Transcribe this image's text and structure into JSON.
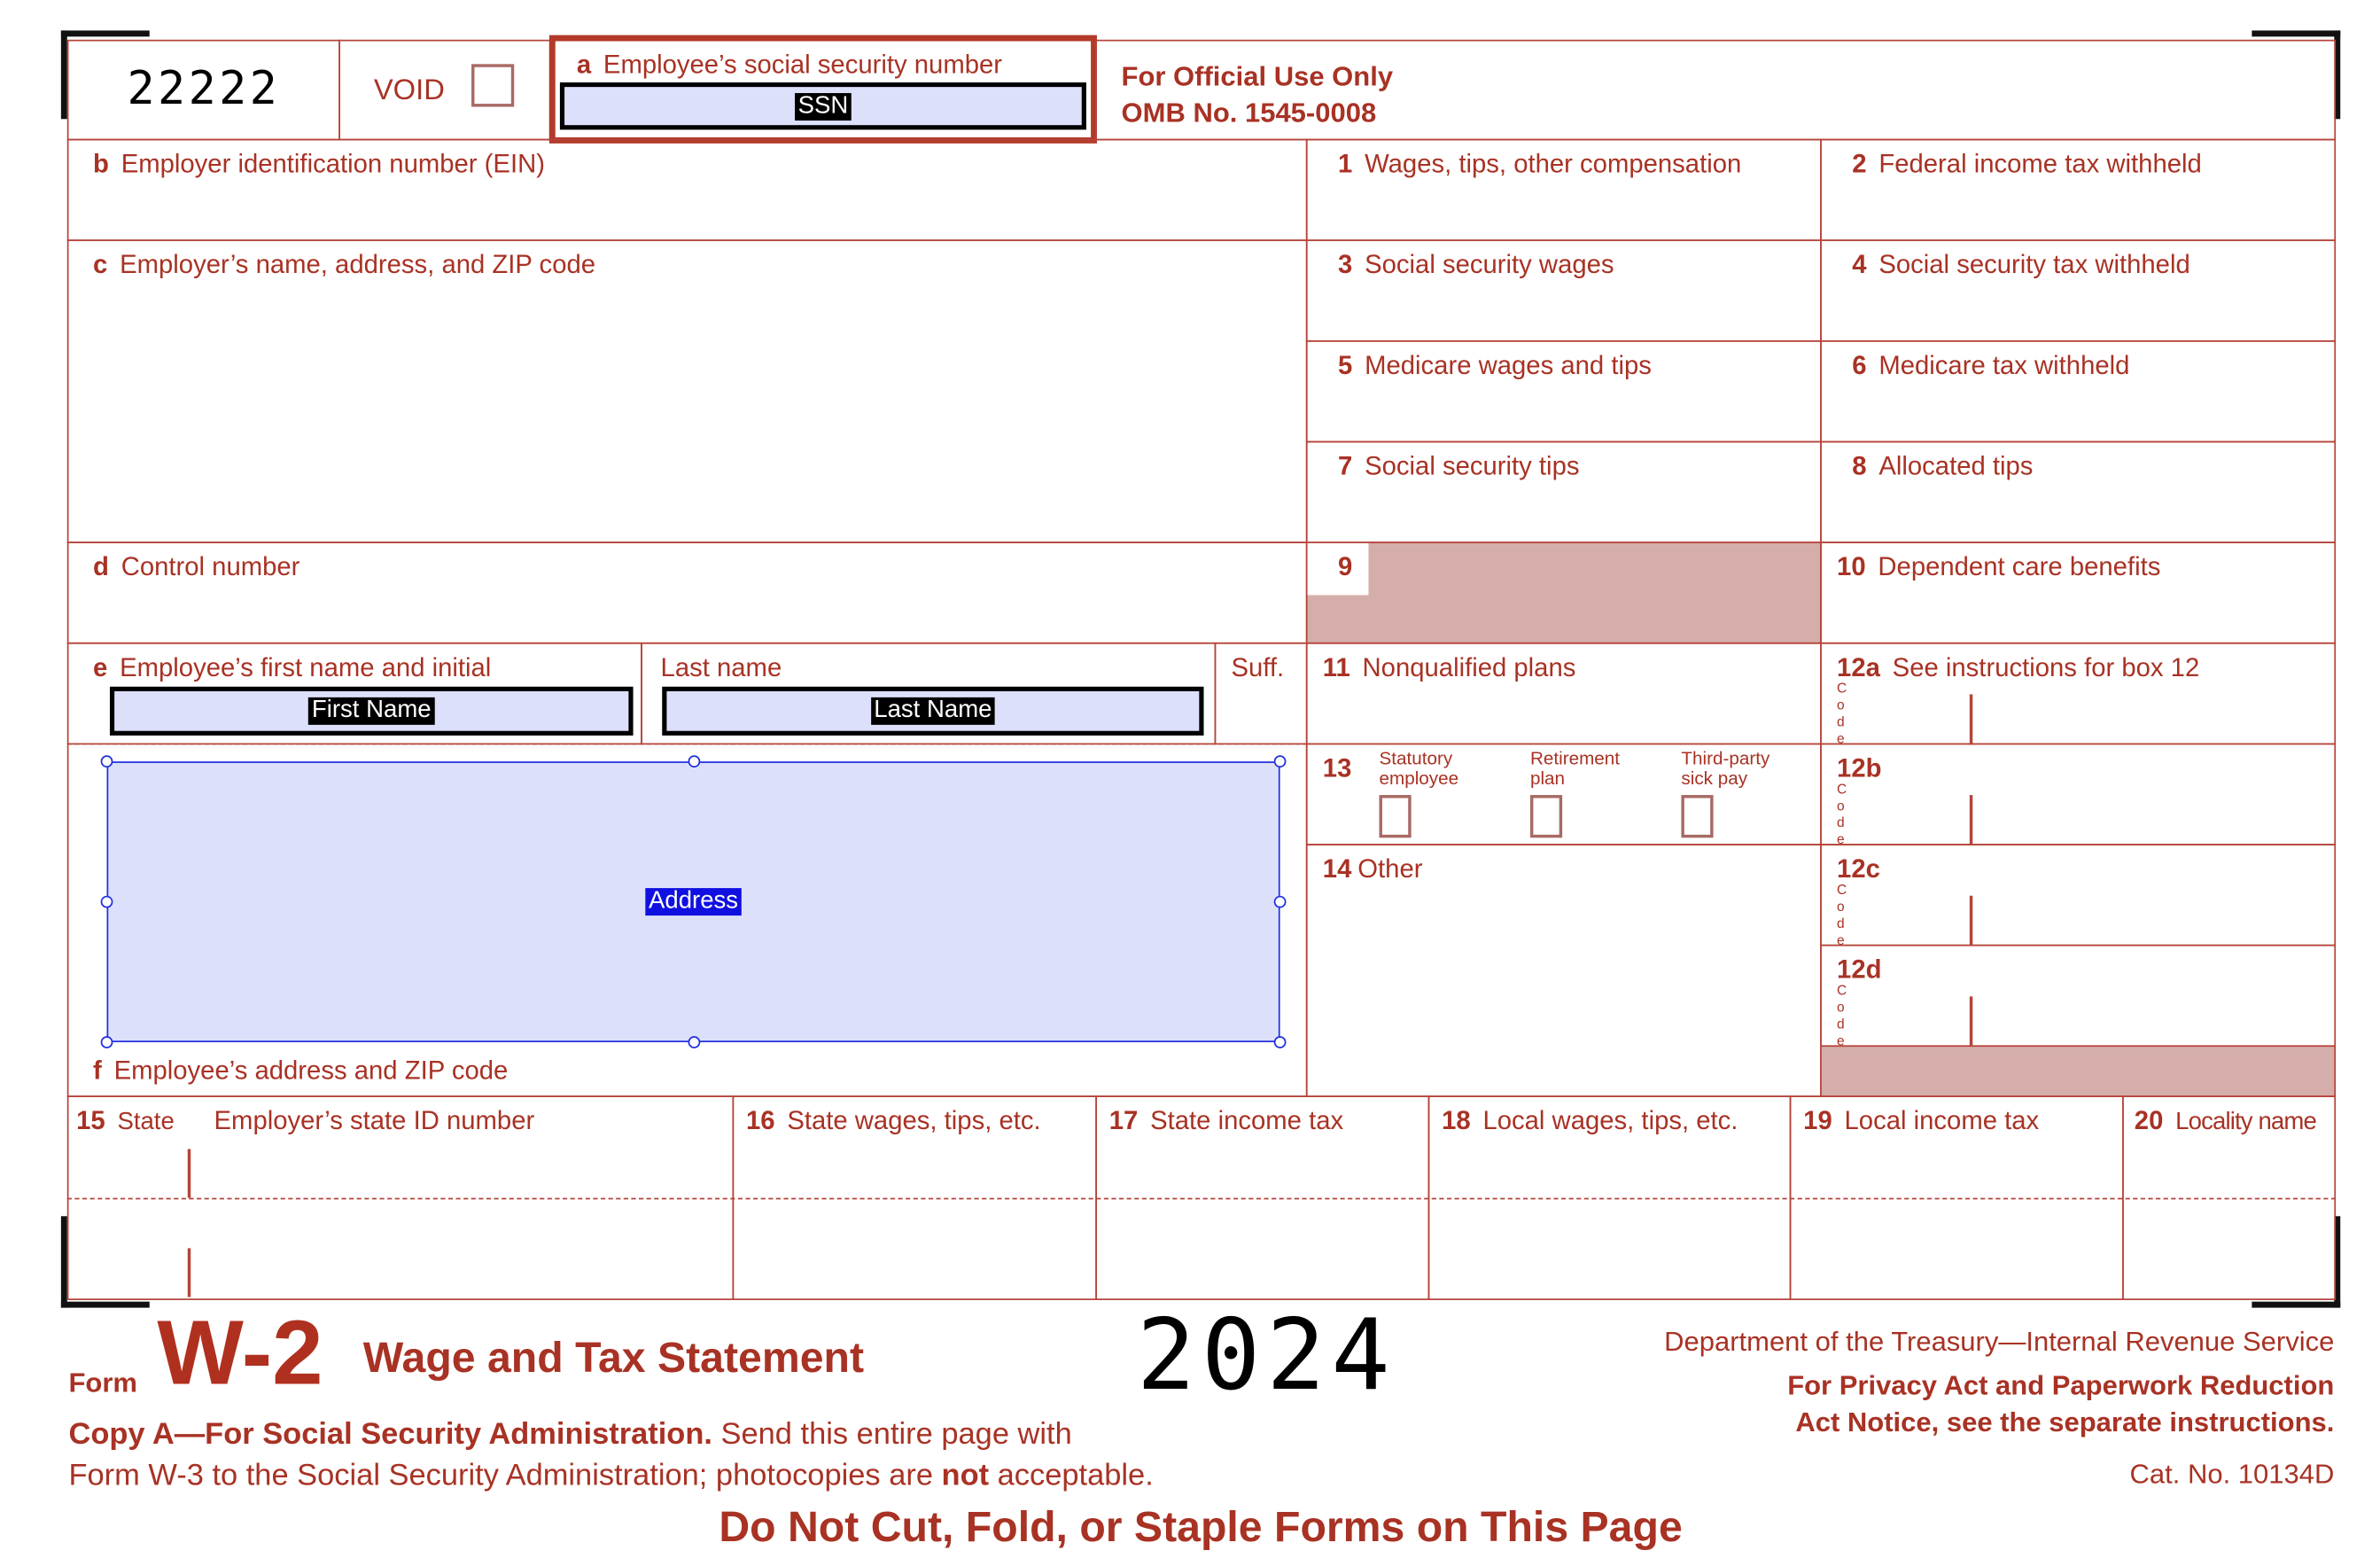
{
  "form_code": "22222",
  "void_label": "VOID",
  "box_a": {
    "letter": "a",
    "label": "Employee’s social security number",
    "field": "SSN"
  },
  "official": {
    "line1": "For Official Use Only",
    "line2": "OMB No. 1545-0008"
  },
  "box_b": {
    "letter": "b",
    "label": "Employer identification number (EIN)"
  },
  "box_c": {
    "letter": "c",
    "label": "Employer’s name, address, and ZIP code"
  },
  "box_d": {
    "letter": "d",
    "label": "Control number"
  },
  "box_e": {
    "letter": "e",
    "label": "Employee’s first name and initial",
    "last": "Last name",
    "suff": "Suff.",
    "first_field": "First Name",
    "last_field": "Last Name"
  },
  "box_f": {
    "letter": "f",
    "label": "Employee’s address and ZIP code",
    "field": "Address"
  },
  "boxes": [
    {
      "n": "1",
      "label": "Wages, tips, other compensation"
    },
    {
      "n": "2",
      "label": "Federal income tax withheld"
    },
    {
      "n": "3",
      "label": "Social security wages"
    },
    {
      "n": "4",
      "label": "Social security tax withheld"
    },
    {
      "n": "5",
      "label": "Medicare wages and tips"
    },
    {
      "n": "6",
      "label": "Medicare tax withheld"
    },
    {
      "n": "7",
      "label": "Social security tips"
    },
    {
      "n": "8",
      "label": "Allocated tips"
    },
    {
      "n": "9",
      "label": ""
    },
    {
      "n": "10",
      "label": "Dependent care benefits"
    },
    {
      "n": "11",
      "label": "Nonqualified plans"
    },
    {
      "n": "12a",
      "label": "See instructions for box 12"
    },
    {
      "n": "13",
      "label": ""
    },
    {
      "n": "12b",
      "label": ""
    },
    {
      "n": "14",
      "label": "Other"
    },
    {
      "n": "12c",
      "label": ""
    },
    {
      "n": "12d",
      "label": ""
    }
  ],
  "box13": {
    "statutory": [
      "Statutory",
      "employee"
    ],
    "retirement": [
      "Retirement",
      "plan"
    ],
    "thirdparty": [
      "Third-party",
      "sick pay"
    ]
  },
  "code_label": "Code",
  "state_row": [
    {
      "n": "15",
      "label": "State",
      "label2": "Employer’s state ID number"
    },
    {
      "n": "16",
      "label": "State wages, tips, etc."
    },
    {
      "n": "17",
      "label": "State income tax"
    },
    {
      "n": "18",
      "label": "Local wages, tips, etc."
    },
    {
      "n": "19",
      "label": "Local income tax"
    },
    {
      "n": "20",
      "label": "Locality name"
    }
  ],
  "footer": {
    "form_word": "Form",
    "form_name": "W-2",
    "title": "Wage and Tax Statement",
    "year": "2024",
    "dept": "Department of the Treasury—Internal Revenue Service",
    "privacy1": "For Privacy Act and Paperwork Reduction",
    "privacy2": "Act Notice, see the separate instructions.",
    "copy_bold": "Copy A—For Social Security Administration.",
    "copy_rest": " Send this entire page with",
    "line2a": "Form W-3 to the Social Security Administration; photocopies are ",
    "line2b": "not",
    "line2c": " acceptable.",
    "cat": "Cat. No. 10134D",
    "warning": "Do Not Cut, Fold, or Staple Forms on This Page"
  }
}
